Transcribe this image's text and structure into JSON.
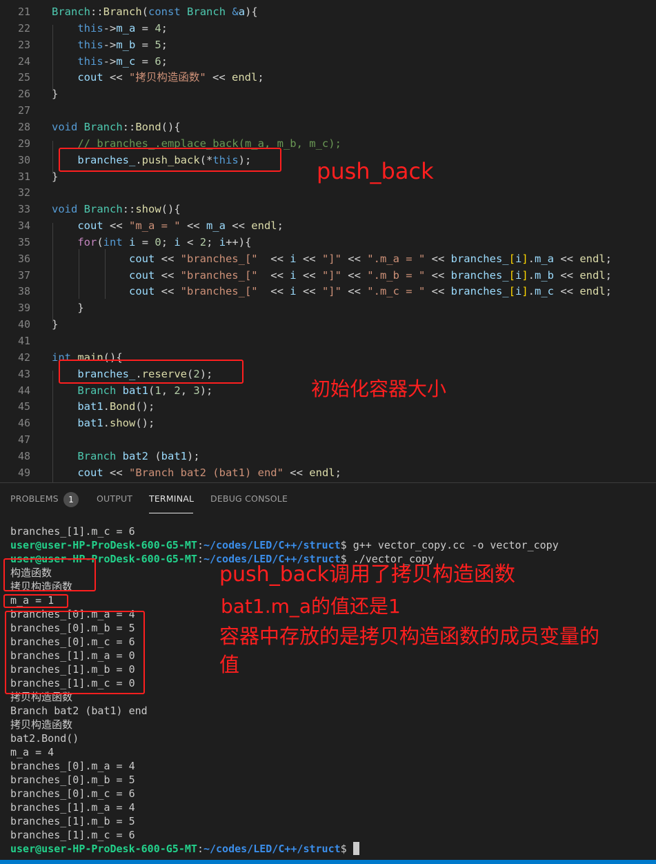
{
  "editor": {
    "lines": [
      {
        "n": "21",
        "tokens": [
          [
            "ty",
            "Branch"
          ],
          [
            "pl",
            "::"
          ],
          [
            "fn",
            "Branch"
          ],
          [
            "pl",
            "("
          ],
          [
            "kw",
            "const"
          ],
          [
            "pl",
            " "
          ],
          [
            "ty",
            "Branch"
          ],
          [
            "pl",
            " "
          ],
          [
            "kw",
            "&"
          ],
          [
            "var",
            "a"
          ],
          [
            "pl",
            "){"
          ]
        ]
      },
      {
        "n": "22",
        "tokens": [
          [
            "pl",
            "    "
          ],
          [
            "kw",
            "this"
          ],
          [
            "pl",
            "->"
          ],
          [
            "var",
            "m_a"
          ],
          [
            "pl",
            " = "
          ],
          [
            "num",
            "4"
          ],
          [
            "pl",
            ";"
          ]
        ]
      },
      {
        "n": "23",
        "tokens": [
          [
            "pl",
            "    "
          ],
          [
            "kw",
            "this"
          ],
          [
            "pl",
            "->"
          ],
          [
            "var",
            "m_b"
          ],
          [
            "pl",
            " = "
          ],
          [
            "num",
            "5"
          ],
          [
            "pl",
            ";"
          ]
        ]
      },
      {
        "n": "24",
        "tokens": [
          [
            "pl",
            "    "
          ],
          [
            "kw",
            "this"
          ],
          [
            "pl",
            "->"
          ],
          [
            "var",
            "m_c"
          ],
          [
            "pl",
            " = "
          ],
          [
            "num",
            "6"
          ],
          [
            "pl",
            ";"
          ]
        ]
      },
      {
        "n": "25",
        "tokens": [
          [
            "pl",
            "    "
          ],
          [
            "var",
            "cout"
          ],
          [
            "pl",
            " << "
          ],
          [
            "str",
            "\"拷贝构造函数\""
          ],
          [
            "pl",
            " << "
          ],
          [
            "fn",
            "endl"
          ],
          [
            "pl",
            ";"
          ]
        ]
      },
      {
        "n": "26",
        "tokens": [
          [
            "pl",
            "}"
          ]
        ]
      },
      {
        "n": "27",
        "tokens": []
      },
      {
        "n": "28",
        "tokens": [
          [
            "kw",
            "void"
          ],
          [
            "pl",
            " "
          ],
          [
            "ty",
            "Branch"
          ],
          [
            "pl",
            "::"
          ],
          [
            "fn",
            "Bond"
          ],
          [
            "pl",
            "(){"
          ]
        ]
      },
      {
        "n": "29",
        "tokens": [
          [
            "pl",
            "    "
          ],
          [
            "cm",
            "// branches_.emplace_back(m_a, m_b, m_c);"
          ]
        ]
      },
      {
        "n": "30",
        "tokens": [
          [
            "pl",
            "    "
          ],
          [
            "var",
            "branches_"
          ],
          [
            "pl",
            "."
          ],
          [
            "fn",
            "push_back"
          ],
          [
            "pl",
            "(*"
          ],
          [
            "kw",
            "this"
          ],
          [
            "pl",
            ");"
          ]
        ]
      },
      {
        "n": "31",
        "tokens": [
          [
            "pl",
            "}"
          ]
        ]
      },
      {
        "n": "32",
        "tokens": []
      },
      {
        "n": "33",
        "tokens": [
          [
            "kw",
            "void"
          ],
          [
            "pl",
            " "
          ],
          [
            "ty",
            "Branch"
          ],
          [
            "pl",
            "::"
          ],
          [
            "fn",
            "show"
          ],
          [
            "pl",
            "(){"
          ]
        ]
      },
      {
        "n": "34",
        "tokens": [
          [
            "pl",
            "    "
          ],
          [
            "var",
            "cout"
          ],
          [
            "pl",
            " << "
          ],
          [
            "str",
            "\"m_a = \""
          ],
          [
            "pl",
            " << "
          ],
          [
            "var",
            "m_a"
          ],
          [
            "pl",
            " << "
          ],
          [
            "fn",
            "endl"
          ],
          [
            "pl",
            ";"
          ]
        ]
      },
      {
        "n": "35",
        "tokens": [
          [
            "pl",
            "    "
          ],
          [
            "ctl",
            "for"
          ],
          [
            "pl",
            "("
          ],
          [
            "kw",
            "int"
          ],
          [
            "pl",
            " "
          ],
          [
            "var",
            "i"
          ],
          [
            "pl",
            " = "
          ],
          [
            "num",
            "0"
          ],
          [
            "pl",
            "; "
          ],
          [
            "var",
            "i"
          ],
          [
            "pl",
            " < "
          ],
          [
            "num",
            "2"
          ],
          [
            "pl",
            "; "
          ],
          [
            "var",
            "i"
          ],
          [
            "pl",
            "++){"
          ]
        ]
      },
      {
        "n": "36",
        "tokens": [
          [
            "pl",
            "            "
          ],
          [
            "var",
            "cout"
          ],
          [
            "pl",
            " << "
          ],
          [
            "str",
            "\"branches_[\""
          ],
          [
            "pl",
            "  << "
          ],
          [
            "var",
            "i"
          ],
          [
            "pl",
            " << "
          ],
          [
            "str",
            "\"]\""
          ],
          [
            "pl",
            " << "
          ],
          [
            "str",
            "\".m_a = \""
          ],
          [
            "pl",
            " << "
          ],
          [
            "var",
            "branches_"
          ],
          [
            "br",
            "["
          ],
          [
            "var",
            "i"
          ],
          [
            "br",
            "]"
          ],
          [
            "pl",
            "."
          ],
          [
            "var",
            "m_a"
          ],
          [
            "pl",
            " << "
          ],
          [
            "fn",
            "endl"
          ],
          [
            "pl",
            ";"
          ]
        ]
      },
      {
        "n": "37",
        "tokens": [
          [
            "pl",
            "            "
          ],
          [
            "var",
            "cout"
          ],
          [
            "pl",
            " << "
          ],
          [
            "str",
            "\"branches_[\""
          ],
          [
            "pl",
            "  << "
          ],
          [
            "var",
            "i"
          ],
          [
            "pl",
            " << "
          ],
          [
            "str",
            "\"]\""
          ],
          [
            "pl",
            " << "
          ],
          [
            "str",
            "\".m_b = \""
          ],
          [
            "pl",
            " << "
          ],
          [
            "var",
            "branches_"
          ],
          [
            "br",
            "["
          ],
          [
            "var",
            "i"
          ],
          [
            "br",
            "]"
          ],
          [
            "pl",
            "."
          ],
          [
            "var",
            "m_b"
          ],
          [
            "pl",
            " << "
          ],
          [
            "fn",
            "endl"
          ],
          [
            "pl",
            ";"
          ]
        ]
      },
      {
        "n": "38",
        "tokens": [
          [
            "pl",
            "            "
          ],
          [
            "var",
            "cout"
          ],
          [
            "pl",
            " << "
          ],
          [
            "str",
            "\"branches_[\""
          ],
          [
            "pl",
            "  << "
          ],
          [
            "var",
            "i"
          ],
          [
            "pl",
            " << "
          ],
          [
            "str",
            "\"]\""
          ],
          [
            "pl",
            " << "
          ],
          [
            "str",
            "\".m_c = \""
          ],
          [
            "pl",
            " << "
          ],
          [
            "var",
            "branches_"
          ],
          [
            "br",
            "["
          ],
          [
            "var",
            "i"
          ],
          [
            "br",
            "]"
          ],
          [
            "pl",
            "."
          ],
          [
            "var",
            "m_c"
          ],
          [
            "pl",
            " << "
          ],
          [
            "fn",
            "endl"
          ],
          [
            "pl",
            ";"
          ]
        ]
      },
      {
        "n": "39",
        "tokens": [
          [
            "pl",
            "    }"
          ]
        ]
      },
      {
        "n": "40",
        "tokens": [
          [
            "pl",
            "}"
          ]
        ]
      },
      {
        "n": "41",
        "tokens": []
      },
      {
        "n": "42",
        "tokens": [
          [
            "kw",
            "int"
          ],
          [
            "pl",
            " "
          ],
          [
            "fn",
            "main"
          ],
          [
            "pl",
            "(){"
          ]
        ]
      },
      {
        "n": "43",
        "tokens": [
          [
            "pl",
            "    "
          ],
          [
            "var",
            "branches_"
          ],
          [
            "pl",
            "."
          ],
          [
            "fn",
            "reserve"
          ],
          [
            "pl",
            "("
          ],
          [
            "num",
            "2"
          ],
          [
            "pl",
            ");"
          ]
        ]
      },
      {
        "n": "44",
        "tokens": [
          [
            "pl",
            "    "
          ],
          [
            "ty",
            "Branch"
          ],
          [
            "pl",
            " "
          ],
          [
            "var",
            "bat1"
          ],
          [
            "pl",
            "("
          ],
          [
            "num",
            "1"
          ],
          [
            "pl",
            ", "
          ],
          [
            "num",
            "2"
          ],
          [
            "pl",
            ", "
          ],
          [
            "num",
            "3"
          ],
          [
            "pl",
            ");"
          ]
        ]
      },
      {
        "n": "45",
        "tokens": [
          [
            "pl",
            "    "
          ],
          [
            "var",
            "bat1"
          ],
          [
            "pl",
            "."
          ],
          [
            "fn",
            "Bond"
          ],
          [
            "pl",
            "();"
          ]
        ]
      },
      {
        "n": "46",
        "tokens": [
          [
            "pl",
            "    "
          ],
          [
            "var",
            "bat1"
          ],
          [
            "pl",
            "."
          ],
          [
            "fn",
            "show"
          ],
          [
            "pl",
            "();"
          ]
        ]
      },
      {
        "n": "47",
        "tokens": []
      },
      {
        "n": "48",
        "tokens": [
          [
            "pl",
            "    "
          ],
          [
            "ty",
            "Branch"
          ],
          [
            "pl",
            " "
          ],
          [
            "var",
            "bat2"
          ],
          [
            "pl",
            " ("
          ],
          [
            "var",
            "bat1"
          ],
          [
            "pl",
            ");"
          ]
        ]
      },
      {
        "n": "49",
        "tokens": [
          [
            "pl",
            "    "
          ],
          [
            "var",
            "cout"
          ],
          [
            "pl",
            " << "
          ],
          [
            "str",
            "\"Branch bat2 (bat1) end\""
          ],
          [
            "pl",
            " << "
          ],
          [
            "fn",
            "endl"
          ],
          [
            "pl",
            ";"
          ]
        ]
      }
    ]
  },
  "annotations": {
    "push_back": "push_back",
    "reserve": "初始化容器大小",
    "copy_called": "push_back调用了拷贝构造函数",
    "value_still": "bat1.m_a的值还是1",
    "container_line1": "容器中存放的是拷贝构造函数的成员变量的",
    "container_line2": "值"
  },
  "panel": {
    "tabs": [
      {
        "label": "PROBLEMS",
        "badge": "1",
        "active": false
      },
      {
        "label": "OUTPUT",
        "active": false
      },
      {
        "label": "TERMINAL",
        "active": true
      },
      {
        "label": "DEBUG CONSOLE",
        "active": false
      }
    ]
  },
  "terminal": {
    "prompt_user": "user@user-HP-ProDesk-600-G5-MT",
    "prompt_path": "~/codes/LED/C++/struct",
    "lines": [
      {
        "type": "out",
        "text": "branches_[1].m_c = 6"
      },
      {
        "type": "prompt",
        "cmd": " g++ vector_copy.cc -o vector_copy"
      },
      {
        "type": "prompt",
        "cmd": " ./vector_copy"
      },
      {
        "type": "out",
        "text": "构造函数"
      },
      {
        "type": "out",
        "text": "拷贝构造函数"
      },
      {
        "type": "out",
        "text": "m_a = 1"
      },
      {
        "type": "out",
        "text": "branches_[0].m_a = 4"
      },
      {
        "type": "out",
        "text": "branches_[0].m_b = 5"
      },
      {
        "type": "out",
        "text": "branches_[0].m_c = 6"
      },
      {
        "type": "out",
        "text": "branches_[1].m_a = 0"
      },
      {
        "type": "out",
        "text": "branches_[1].m_b = 0"
      },
      {
        "type": "out",
        "text": "branches_[1].m_c = 0"
      },
      {
        "type": "out",
        "text": "拷贝构造函数"
      },
      {
        "type": "out",
        "text": "Branch bat2 (bat1) end"
      },
      {
        "type": "out",
        "text": "拷贝构造函数"
      },
      {
        "type": "out",
        "text": "bat2.Bond()"
      },
      {
        "type": "out",
        "text": "m_a = 4"
      },
      {
        "type": "out",
        "text": "branches_[0].m_a = 4"
      },
      {
        "type": "out",
        "text": "branches_[0].m_b = 5"
      },
      {
        "type": "out",
        "text": "branches_[0].m_c = 6"
      },
      {
        "type": "out",
        "text": "branches_[1].m_a = 4"
      },
      {
        "type": "out",
        "text": "branches_[1].m_b = 5"
      },
      {
        "type": "out",
        "text": "branches_[1].m_c = 6"
      },
      {
        "type": "prompt",
        "cmd": " ",
        "cursor": true
      }
    ]
  }
}
